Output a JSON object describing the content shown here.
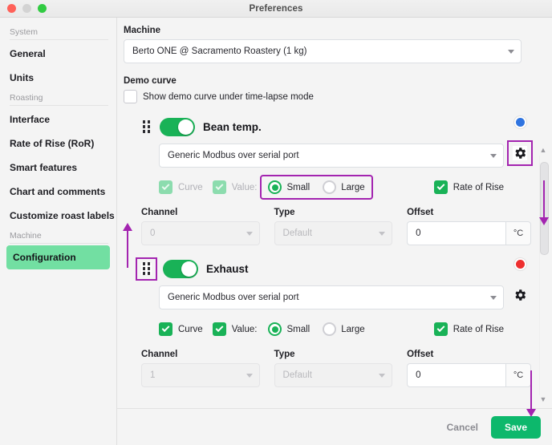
{
  "window": {
    "title": "Preferences",
    "controls": [
      "close",
      "minimize",
      "zoom"
    ]
  },
  "sidebar": {
    "groups": [
      {
        "label": "System",
        "items": [
          {
            "label": "General",
            "active": false
          },
          {
            "label": "Units",
            "active": false
          }
        ]
      },
      {
        "label": "Roasting",
        "items": [
          {
            "label": "Interface",
            "active": false
          },
          {
            "label": "Rate of Rise (RoR)",
            "active": false
          },
          {
            "label": "Smart features",
            "active": false
          },
          {
            "label": "Chart and comments",
            "active": false
          },
          {
            "label": "Customize roast labels",
            "active": false
          }
        ]
      },
      {
        "label": "Machine",
        "items": [
          {
            "label": "Configuration",
            "active": true
          }
        ]
      }
    ]
  },
  "main": {
    "machine": {
      "label": "Machine",
      "value": "Berto ONE @ Sacramento Roastery (1 kg)"
    },
    "demo_curve": {
      "label": "Demo curve",
      "checkbox_label": "Show demo curve under time-lapse mode",
      "checked": false
    },
    "channels": [
      {
        "name": "Bean temp.",
        "enabled": true,
        "dot_color": "#2f74e0",
        "device": "Generic Modbus over serial port",
        "curve": {
          "label": "Curve",
          "checked": true,
          "disabled": true
        },
        "value": {
          "label": "Value:",
          "checked": true,
          "disabled": true
        },
        "size": {
          "selected": "Small",
          "options": [
            "Small",
            "Large"
          ]
        },
        "rate_of_rise": {
          "label": "Rate of Rise",
          "checked": true
        },
        "channel": {
          "label": "Channel",
          "value": "0",
          "disabled": true
        },
        "type": {
          "label": "Type",
          "value": "Default",
          "disabled": true
        },
        "offset": {
          "label": "Offset",
          "value": "0",
          "unit": "°C"
        }
      },
      {
        "name": "Exhaust",
        "enabled": true,
        "dot_color": "#ee2f2f",
        "device": "Generic Modbus over serial port",
        "curve": {
          "label": "Curve",
          "checked": true,
          "disabled": false
        },
        "value": {
          "label": "Value:",
          "checked": true,
          "disabled": false
        },
        "size": {
          "selected": "Small",
          "options": [
            "Small",
            "Large"
          ]
        },
        "rate_of_rise": {
          "label": "Rate of Rise",
          "checked": true
        },
        "channel": {
          "label": "Channel",
          "value": "1",
          "disabled": true
        },
        "type": {
          "label": "Type",
          "value": "Default",
          "disabled": true
        },
        "offset": {
          "label": "Offset",
          "value": "0",
          "unit": "°C"
        }
      }
    ]
  },
  "footer": {
    "cancel_label": "Cancel",
    "save_label": "Save"
  },
  "annotations": {
    "highlight_color": "#a324b0",
    "boxes": [
      "size-radio-group",
      "bean-temp-gear",
      "exhaust-drag-handle"
    ],
    "arrows": [
      "up-to-bean-temp-row",
      "down-scrollbar",
      "down-to-save"
    ]
  }
}
